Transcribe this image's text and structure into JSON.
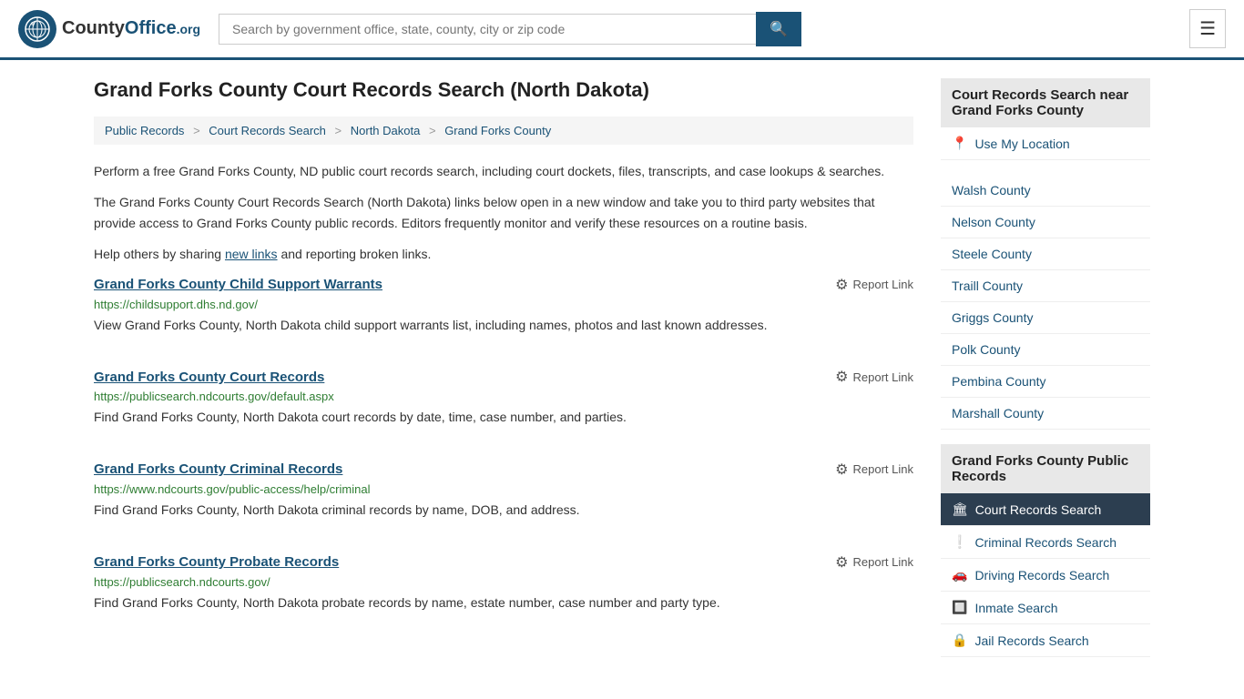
{
  "header": {
    "logo_text": "CountyOffice",
    "logo_org": ".org",
    "search_placeholder": "Search by government office, state, county, city or zip code",
    "search_value": ""
  },
  "page": {
    "title": "Grand Forks County Court Records Search (North Dakota)",
    "breadcrumb": [
      {
        "label": "Public Records",
        "href": "#"
      },
      {
        "label": "Court Records Search",
        "href": "#"
      },
      {
        "label": "North Dakota",
        "href": "#"
      },
      {
        "label": "Grand Forks County",
        "href": "#"
      }
    ],
    "description1": "Perform a free Grand Forks County, ND public court records search, including court dockets, files, transcripts, and case lookups & searches.",
    "description2": "The Grand Forks County Court Records Search (North Dakota) links below open in a new window and take you to third party websites that provide access to Grand Forks County public records. Editors frequently monitor and verify these resources on a routine basis.",
    "description3_prefix": "Help others by sharing ",
    "description3_link": "new links",
    "description3_suffix": " and reporting broken links."
  },
  "results": [
    {
      "title": "Grand Forks County Child Support Warrants",
      "url": "https://childsupport.dhs.nd.gov/",
      "description": "View Grand Forks County, North Dakota child support warrants list, including names, photos and last known addresses.",
      "report_label": "Report Link"
    },
    {
      "title": "Grand Forks County Court Records",
      "url": "https://publicsearch.ndcourts.gov/default.aspx",
      "description": "Find Grand Forks County, North Dakota court records by date, time, case number, and parties.",
      "report_label": "Report Link"
    },
    {
      "title": "Grand Forks County Criminal Records",
      "url": "https://www.ndcourts.gov/public-access/help/criminal",
      "description": "Find Grand Forks County, North Dakota criminal records by name, DOB, and address.",
      "report_label": "Report Link"
    },
    {
      "title": "Grand Forks County Probate Records",
      "url": "https://publicsearch.ndcourts.gov/",
      "description": "Find Grand Forks County, North Dakota probate records by name, estate number, case number and party type.",
      "report_label": "Report Link"
    }
  ],
  "sidebar": {
    "nearby_title": "Court Records Search near Grand Forks County",
    "use_location_label": "Use My Location",
    "nearby_counties": [
      "Walsh County",
      "Nelson County",
      "Steele County",
      "Traill County",
      "Griggs County",
      "Polk County",
      "Pembina County",
      "Marshall County"
    ],
    "public_records_title": "Grand Forks County Public Records",
    "public_records_items": [
      {
        "label": "Court Records Search",
        "icon": "🏛",
        "active": true
      },
      {
        "label": "Criminal Records Search",
        "icon": "❕",
        "active": false
      },
      {
        "label": "Driving Records Search",
        "icon": "🚗",
        "active": false
      },
      {
        "label": "Inmate Search",
        "icon": "🔲",
        "active": false
      },
      {
        "label": "Jail Records Search",
        "icon": "🔒",
        "active": false
      }
    ]
  }
}
